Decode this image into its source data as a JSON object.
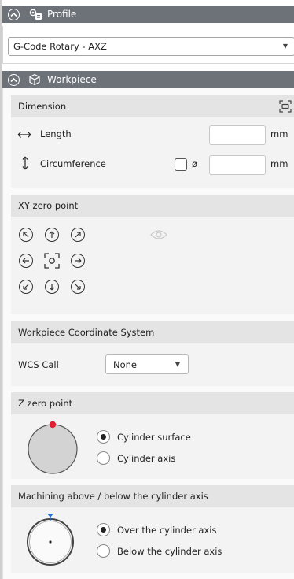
{
  "profile": {
    "title": "Profile",
    "selected": "G-Code Rotary - AXZ"
  },
  "workpiece": {
    "title": "Workpiece",
    "dimension": {
      "heading": "Dimension",
      "length_label": "Length",
      "length_value": "",
      "length_unit": "mm",
      "circumference_label": "Circumference",
      "diameter_symbol": "ø",
      "circumference_value": "",
      "circumference_unit": "mm"
    },
    "xy_zero": {
      "heading": "XY zero point"
    },
    "wcs": {
      "heading": "Workpiece Coordinate System",
      "call_label": "WCS Call",
      "selected": "None"
    },
    "z_zero": {
      "heading": "Z zero point",
      "options": [
        "Cylinder surface",
        "Cylinder axis"
      ]
    },
    "machining": {
      "heading": "Machining above / below the cylinder axis",
      "options": [
        "Over the cylinder axis",
        "Below the cylinder axis"
      ]
    }
  },
  "colors": {
    "header_bg": "#6d7279",
    "card_head": "#e4e4e4",
    "marker_red": "#e02030",
    "marker_blue": "#2a6fd0"
  }
}
